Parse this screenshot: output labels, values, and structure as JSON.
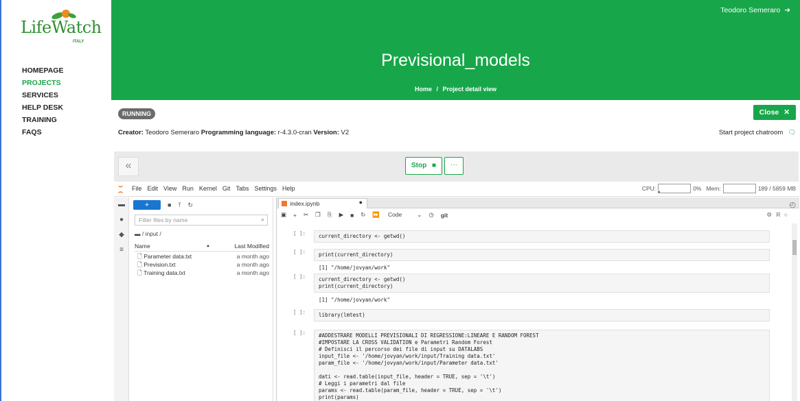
{
  "sidebar": {
    "logo_text": "LifeWatch",
    "logo_sub": "ITALY",
    "nav": [
      "HOMEPAGE",
      "PROJECTS",
      "SERVICES",
      "HELP DESK",
      "TRAINING",
      "FAQS"
    ]
  },
  "header": {
    "user": "Teodoro Semeraro",
    "title": "Previsional_models",
    "breadcrumb_home": "Home",
    "breadcrumb_sep": "/",
    "breadcrumb_current": "Project detail view"
  },
  "info": {
    "status": "RUNNING",
    "close_label": "Close",
    "creator_label": "Creator:",
    "creator": "Teodoro Semeraro",
    "lang_label": "Programming language:",
    "lang": "r-4.3.0-cran",
    "version_label": "Version:",
    "version": "V2",
    "chatroom": "Start project chatroom"
  },
  "session": {
    "collapse": "«",
    "stop_label": "Stop",
    "more_label": "···"
  },
  "jupyter": {
    "menus": [
      "File",
      "Edit",
      "View",
      "Run",
      "Kernel",
      "Git",
      "Tabs",
      "Settings",
      "Help"
    ],
    "cpu_label": "CPU:",
    "cpu_value": "0%",
    "cpu_fill": 0.04,
    "mem_label": "Mem:",
    "mem_value": "189 / 5859 MB",
    "filter_placeholder": "Filter files by name",
    "path": "/ input /",
    "col_name": "Name",
    "col_modified": "Last Modified",
    "files": [
      {
        "name": "Parameter data.txt",
        "modified": "a month ago"
      },
      {
        "name": "Prevision.txt",
        "modified": "a month ago"
      },
      {
        "name": "Training data.txt",
        "modified": "a month ago"
      }
    ],
    "tab_name": "index.ipynb",
    "cell_type": "Code",
    "git_label": "git",
    "kernel": "R",
    "cells": [
      {
        "prompt": "[ ]:",
        "code": "current_directory <- getwd()"
      },
      {
        "prompt": "[ ]:",
        "code": "print(current_directory)",
        "out": "[1] \"/home/jovyan/work\""
      },
      {
        "prompt": "[ ]:",
        "code": "current_directory <- getwd()\nprint(current_directory)",
        "out": "[1] \"/home/jovyan/work\""
      },
      {
        "prompt": "[ ]:",
        "code": "library(lmtest)"
      },
      {
        "prompt": "[ ]:",
        "code": "#ADDESTRARE MODELLI PREVISIONALI DI REGRESSIONE:LINEARE E RANDOM FOREST\n#IMPOSTARE LA CROSS VALIDATION e Parametri Random Forest\n# Definisci il percorso dei file di input su DATALABS\ninput_file <- '/home/jovyan/work/input/Training data.txt'\nparam_file <- '/home/jovyan/work/input/Parameter data.txt'\n\ndati <- read.table(input_file, header = TRUE, sep = '\\t')\n# Leggi i parametri dal file\nparams <- read.table(param_file, header = TRUE, sep = '\\t')\nprint(params)"
      }
    ]
  }
}
